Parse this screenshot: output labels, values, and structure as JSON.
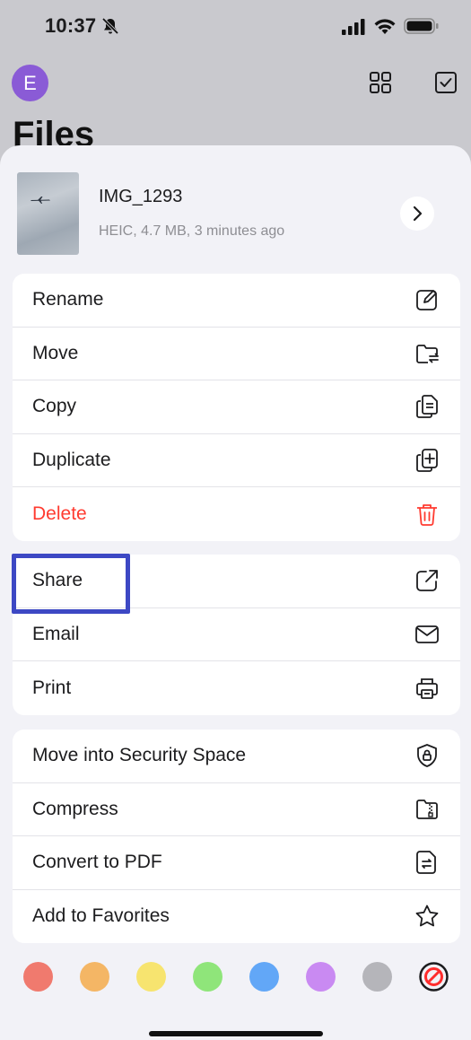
{
  "status": {
    "time": "10:37"
  },
  "header": {
    "avatar_letter": "E",
    "title": "Files"
  },
  "file": {
    "name": "IMG_1293",
    "meta": "HEIC, 4.7 MB, 3 minutes ago"
  },
  "groups": [
    {
      "items": [
        {
          "label": "Rename",
          "icon": "rename-icon"
        },
        {
          "label": "Move",
          "icon": "move-folder-icon"
        },
        {
          "label": "Copy",
          "icon": "copy-icon"
        },
        {
          "label": "Duplicate",
          "icon": "duplicate-icon"
        },
        {
          "label": "Delete",
          "icon": "trash-icon",
          "color": "#ff3b30"
        }
      ]
    },
    {
      "items": [
        {
          "label": "Share",
          "icon": "share-icon"
        },
        {
          "label": "Email",
          "icon": "mail-icon"
        },
        {
          "label": "Print",
          "icon": "printer-icon"
        }
      ]
    },
    {
      "items": [
        {
          "label": "Move into Security Space",
          "icon": "lock-shield-icon"
        },
        {
          "label": "Compress",
          "icon": "zip-folder-icon"
        },
        {
          "label": "Convert to PDF",
          "icon": "convert-pdf-icon"
        },
        {
          "label": "Add to Favorites",
          "icon": "star-icon"
        }
      ]
    }
  ],
  "tag_colors": [
    {
      "name": "red",
      "hex": "#f07a6e"
    },
    {
      "name": "orange",
      "hex": "#f4b665"
    },
    {
      "name": "yellow",
      "hex": "#f7e46f"
    },
    {
      "name": "green",
      "hex": "#8fe57a"
    },
    {
      "name": "blue",
      "hex": "#62a7f7"
    },
    {
      "name": "purple",
      "hex": "#c98af2"
    },
    {
      "name": "gray",
      "hex": "#b5b5ba"
    }
  ],
  "accent": {
    "danger": "#ff3b30",
    "highlight": "#3d48c4"
  }
}
